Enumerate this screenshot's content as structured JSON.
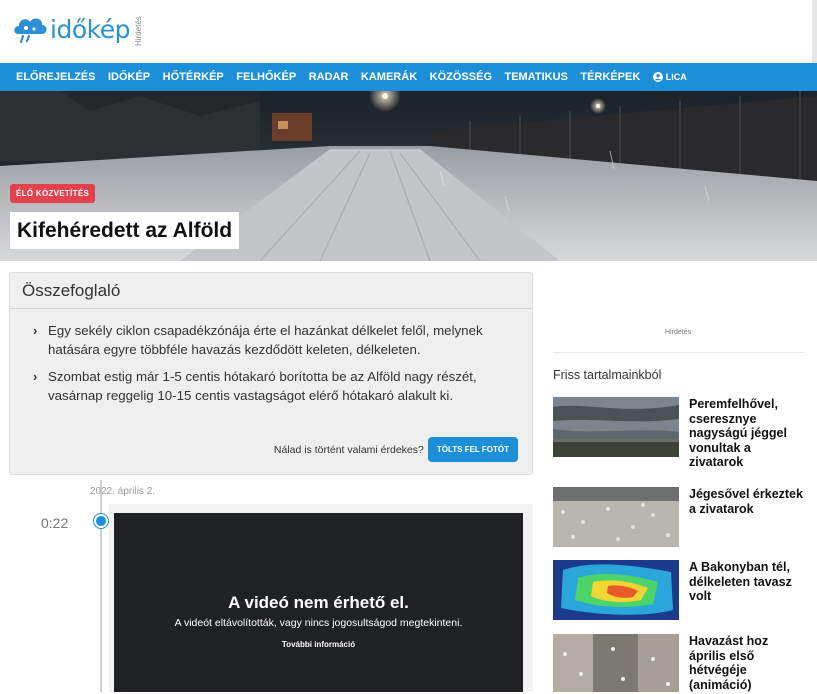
{
  "header": {
    "logo_text": "időkép",
    "ad_label": "Hirdetés"
  },
  "nav": {
    "items": [
      {
        "label": "ELŐREJELZÉS"
      },
      {
        "label": "IDŐKÉP"
      },
      {
        "label": "HŐTÉRKÉP"
      },
      {
        "label": "FELHŐKÉP"
      },
      {
        "label": "RADAR"
      },
      {
        "label": "KAMERÁK"
      },
      {
        "label": "KÖZÖSSÉG"
      },
      {
        "label": "TEMATIKUS"
      },
      {
        "label": "TÉRKÉPEK"
      }
    ],
    "user_label": "LICA",
    "user_icon": "user-circle-icon"
  },
  "hero": {
    "badge": "ÉLŐ KÖZVETÍTÉS",
    "title": "Kifehéredett az Alföld"
  },
  "summary": {
    "heading": "Összefoglaló",
    "bullets": [
      "Egy sekély ciklon csapadékzónája érte el hazánkat délkelet felől, melynek hatására egyre többféle havazás kezdődött keleten, délkeleten.",
      "Szombat estig már 1-5 centis hótakaró borította be az Alföld nagy részét, vasárnap reggelig 10-15 centis vastagságot elérő hótakaró alakult ki."
    ],
    "upload_question": "Nálad is történt valami érdekes?",
    "upload_button": "TÖLTS FEL FOTÓT"
  },
  "timeline": {
    "date": "2022. április 2.",
    "time": "0:22",
    "video": {
      "title": "A videó nem érhető el.",
      "subtitle": "A videót eltávolították, vagy nincs jogosultságod megtekinteni.",
      "link": "További információ"
    }
  },
  "sidebar": {
    "ad_label": "Hirdetés",
    "section_title": "Friss tartalmainkból",
    "articles": [
      {
        "title": "Peremfelhővel, cseresznye nagyságú jéggel vonultak a zivatarok"
      },
      {
        "title": "Jégesővel érkeztek a zivatarok"
      },
      {
        "title": "A Bakonyban tél, délkeleten tavasz volt"
      },
      {
        "title": "Havazást hoz április első hétvégéje (animáció)"
      }
    ]
  },
  "colors": {
    "brand_blue": "#1c8fd8",
    "live_red": "#e3414b",
    "video_bg": "#202124"
  }
}
